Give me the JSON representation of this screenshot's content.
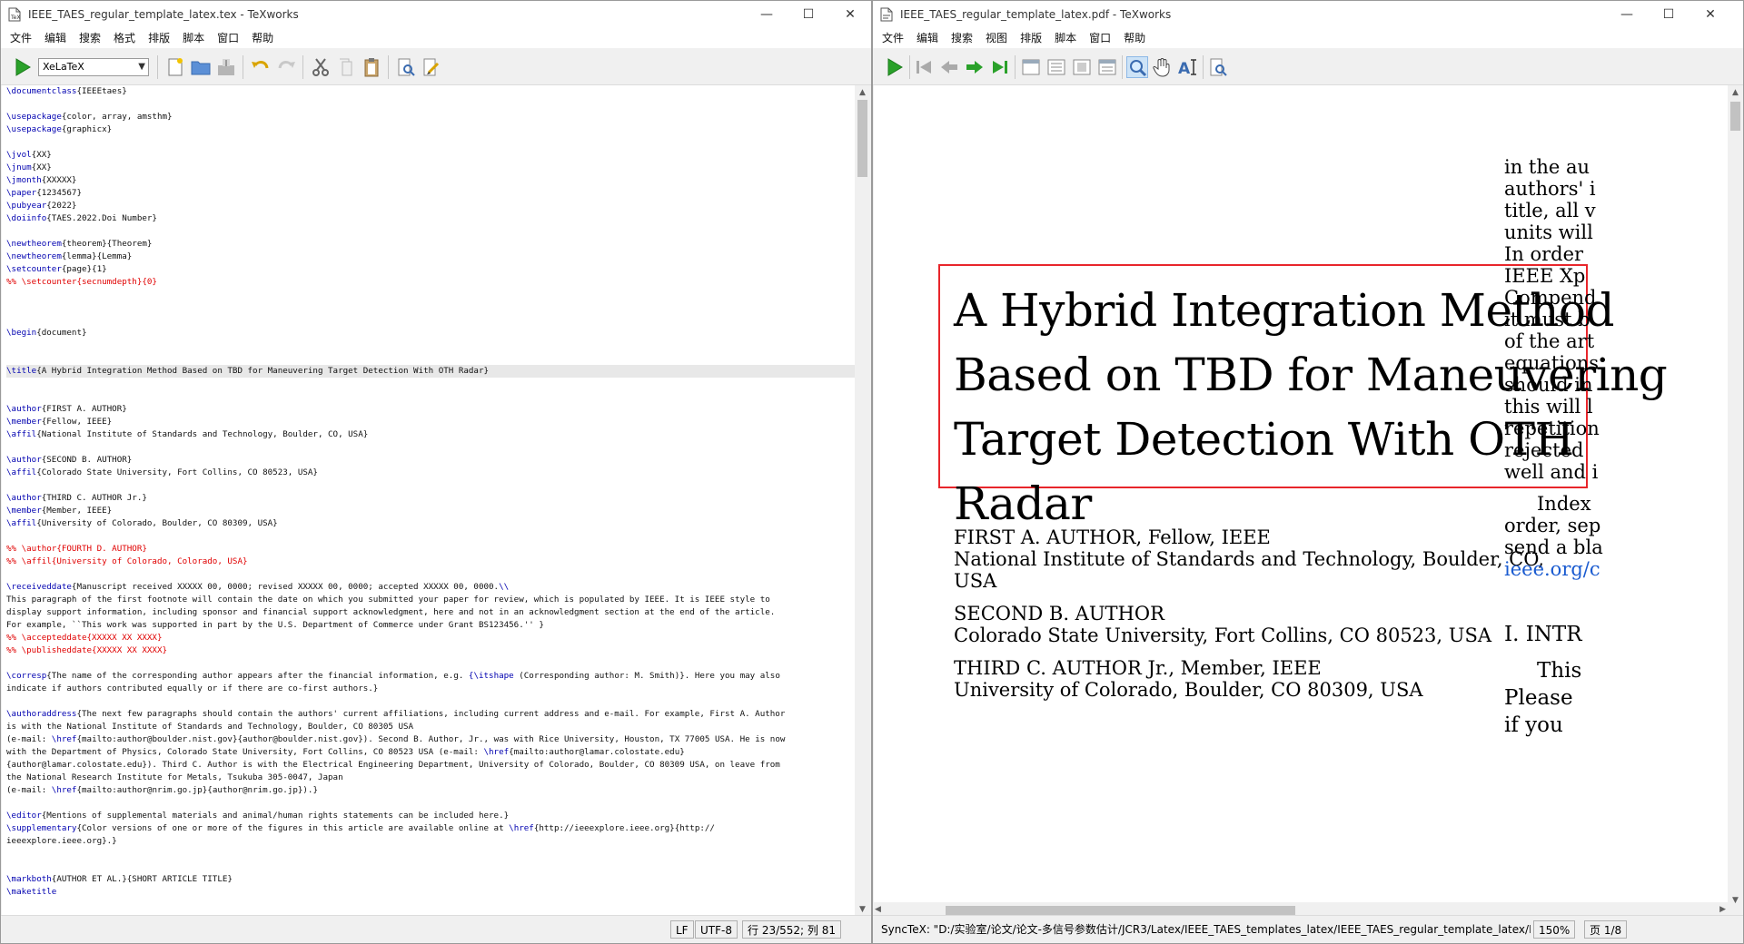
{
  "left_window": {
    "title": "IEEE_TAES_regular_template_latex.tex - TeXworks",
    "menus": [
      "文件",
      "编辑",
      "搜索",
      "格式",
      "排版",
      "脚本",
      "窗口",
      "帮助"
    ],
    "typeset_engine": "XeLaTeX",
    "status": {
      "line_ending": "LF",
      "encoding": "UTF-8",
      "position": "行 23/552; 列 81"
    },
    "code_lines": [
      [
        [
          "c",
          "\\documentclass"
        ],
        [
          "a",
          "{IEEEtaes}"
        ]
      ],
      [],
      [
        [
          "c",
          "\\usepackage"
        ],
        [
          "a",
          "{color, array, amsthm}"
        ]
      ],
      [
        [
          "c",
          "\\usepackage"
        ],
        [
          "a",
          "{graphicx}"
        ]
      ],
      [],
      [
        [
          "c",
          "\\jvol"
        ],
        [
          "a",
          "{XX}"
        ]
      ],
      [
        [
          "c",
          "\\jnum"
        ],
        [
          "a",
          "{XX}"
        ]
      ],
      [
        [
          "c",
          "\\jmonth"
        ],
        [
          "a",
          "{XXXXX}"
        ]
      ],
      [
        [
          "c",
          "\\paper"
        ],
        [
          "a",
          "{1234567}"
        ]
      ],
      [
        [
          "c",
          "\\pubyear"
        ],
        [
          "a",
          "{2022}"
        ]
      ],
      [
        [
          "c",
          "\\doiinfo"
        ],
        [
          "a",
          "{TAES.2022.Doi Number}"
        ]
      ],
      [],
      [
        [
          "c",
          "\\newtheorem"
        ],
        [
          "a",
          "{theorem}{Theorem}"
        ]
      ],
      [
        [
          "c",
          "\\newtheorem"
        ],
        [
          "a",
          "{lemma}{Lemma}"
        ]
      ],
      [
        [
          "c",
          "\\setcounter"
        ],
        [
          "a",
          "{page}{1}"
        ]
      ],
      [
        [
          "r",
          "%% \\setcounter{secnumdepth}{0}"
        ]
      ],
      [],
      [],
      [],
      [
        [
          "c",
          "\\begin"
        ],
        [
          "a",
          "{document}"
        ]
      ],
      [],
      [],
      [
        [
          "c",
          "\\title"
        ],
        [
          "a",
          "{A Hybrid Integration Method Based on TBD for Maneuvering Target Detection With OTH Radar}"
        ]
      ],
      [],
      [],
      [
        [
          "c",
          "\\author"
        ],
        [
          "a",
          "{FIRST A. AUTHOR}"
        ]
      ],
      [
        [
          "c",
          "\\member"
        ],
        [
          "a",
          "{Fellow, IEEE}"
        ]
      ],
      [
        [
          "c",
          "\\affil"
        ],
        [
          "a",
          "{National Institute of Standards and Technology, Boulder, CO, USA}"
        ]
      ],
      [],
      [
        [
          "c",
          "\\author"
        ],
        [
          "a",
          "{SECOND B. AUTHOR}"
        ]
      ],
      [
        [
          "c",
          "\\affil"
        ],
        [
          "a",
          "{Colorado State University, Fort Collins, CO 80523, USA}"
        ]
      ],
      [],
      [
        [
          "c",
          "\\author"
        ],
        [
          "a",
          "{THIRD C. AUTHOR Jr.}"
        ]
      ],
      [
        [
          "c",
          "\\member"
        ],
        [
          "a",
          "{Member, IEEE}"
        ]
      ],
      [
        [
          "c",
          "\\affil"
        ],
        [
          "a",
          "{University of Colorado, Boulder, CO 80309, USA}"
        ]
      ],
      [],
      [
        [
          "r",
          "%% \\author{FOURTH D. AUTHOR}"
        ]
      ],
      [
        [
          "r",
          "%% \\affil{University of Colorado, Colorado, USA}"
        ]
      ],
      [],
      [
        [
          "c",
          "\\receiveddate"
        ],
        [
          "a",
          "{Manuscript received XXXXX 00, 0000; revised XXXXX 00, 0000; accepted XXXXX 00, 0000."
        ],
        [
          "c",
          "\\\\"
        ]
      ],
      [
        [
          "a",
          "This paragraph of the first footnote will contain the date on which you submitted your paper for review, which is populated by IEEE. It is IEEE style to"
        ]
      ],
      [
        [
          "a",
          "display support information, including sponsor and financial support acknowledgment, here and not in an acknowledgment section at the end of the article."
        ]
      ],
      [
        [
          "a",
          "For example, ``This work was supported in part by the U.S. Department of Commerce under Grant BS123456.'' }"
        ]
      ],
      [
        [
          "r",
          "%% \\accepteddate{XXXXX XX XXXX}"
        ]
      ],
      [
        [
          "r",
          "%% \\publisheddate{XXXXX XX XXXX}"
        ]
      ],
      [],
      [
        [
          "c",
          "\\corresp"
        ],
        [
          "a",
          "{The name of the corresponding author appears after the financial information, e.g. "
        ],
        [
          "c",
          "{\\itshape"
        ],
        [
          "a",
          " (Corresponding author: M. Smith)}. Here you may also"
        ]
      ],
      [
        [
          "a",
          "indicate if authors contributed equally or if there are co-first authors.}"
        ]
      ],
      [],
      [
        [
          "c",
          "\\authoraddress"
        ],
        [
          "a",
          "{The next few paragraphs should contain the authors' current affiliations, including current address and e-mail. For example, First A. Author"
        ]
      ],
      [
        [
          "a",
          "is with the National Institute of Standards and Technology, Boulder, CO 80305 USA"
        ]
      ],
      [
        [
          "a",
          "(e-mail: "
        ],
        [
          "c",
          "\\href"
        ],
        [
          "a",
          "{mailto:author@boulder.nist.gov}{author@boulder.nist.gov}). Second B. Author, Jr., was with Rice University, Houston, TX 77005 USA. He is now"
        ]
      ],
      [
        [
          "a",
          "with the Department of Physics, Colorado State University, Fort Collins, CO 80523 USA (e-mail: "
        ],
        [
          "c",
          "\\href"
        ],
        [
          "a",
          "{mailto:author@lamar.colostate.edu}"
        ]
      ],
      [
        [
          "a",
          "{author@lamar.colostate.edu}). Third C. Author is with the Electrical Engineering Department, University of Colorado, Boulder, CO 80309 USA, on leave from"
        ]
      ],
      [
        [
          "a",
          "the National Research Institute for Metals, Tsukuba 305-0047, Japan"
        ]
      ],
      [
        [
          "a",
          "(e-mail: "
        ],
        [
          "c",
          "\\href"
        ],
        [
          "a",
          "{mailto:author@nrim.go.jp}{author@nrim.go.jp}).}"
        ]
      ],
      [],
      [
        [
          "c",
          "\\editor"
        ],
        [
          "a",
          "{Mentions of supplemental materials and animal/human rights statements can be included here.}"
        ]
      ],
      [
        [
          "c",
          "\\supplementary"
        ],
        [
          "a",
          "{Color versions of one or more of the figures in this article are available online at "
        ],
        [
          "c",
          "\\href"
        ],
        [
          "a",
          "{http://ieeexplore.ieee.org}{http://"
        ]
      ],
      [
        [
          "a",
          "ieeexplore.ieee.org}.}"
        ]
      ],
      [],
      [],
      [
        [
          "c",
          "\\markboth"
        ],
        [
          "a",
          "{AUTHOR ET AL.}{SHORT ARTICLE TITLE}"
        ]
      ],
      [
        [
          "c",
          "\\maketitle"
        ]
      ]
    ]
  },
  "right_window": {
    "title": "IEEE_TAES_regular_template_latex.pdf - TeXworks",
    "menus": [
      "文件",
      "编辑",
      "搜索",
      "视图",
      "排版",
      "脚本",
      "窗口",
      "帮助"
    ],
    "pdf": {
      "title_lines": [
        "A Hybrid Integration Method",
        "Based on TBD for Maneuvering",
        "Target Detection With OTH",
        "Radar"
      ],
      "author1_name": "FIRST A. AUTHOR, Fellow, IEEE",
      "author1_affil_1": "National Institute of Standards and Technology, Boulder, CO,",
      "author1_affil_2": "USA",
      "author2_name": "SECOND B. AUTHOR",
      "author2_affil": "Colorado State University, Fort Collins, CO 80523, USA",
      "author3_name": "THIRD C. AUTHOR Jr., Member, IEEE",
      "author3_affil": "University of Colorado, Boulder, CO 80309, USA",
      "right_col_1": [
        "in the au",
        "authors' i",
        "title, all v",
        "units will",
        "In order",
        "IEEE Xp",
        "Compend",
        "it must b",
        "of the art",
        "equations",
        "should in",
        "this will l",
        "repetition",
        "rejected",
        "well and i"
      ],
      "right_col_2": [
        "Index",
        "order, sep",
        "send a bla"
      ],
      "right_col_link": "ieee.org/c",
      "section_heading": "I.   INTR",
      "right_col_3": [
        "This",
        "Please",
        "if    you"
      ]
    },
    "status": {
      "synctex": "SyncTeX: \"D:/实验室/论文/论文-多信号参数估计/JCR3/Latex/IEEE_TAES_templates_latex/IEEE_TAES_regular_template_latex/IEEE_TAES_re",
      "zoom": "150%",
      "page": "页 1/8"
    }
  }
}
